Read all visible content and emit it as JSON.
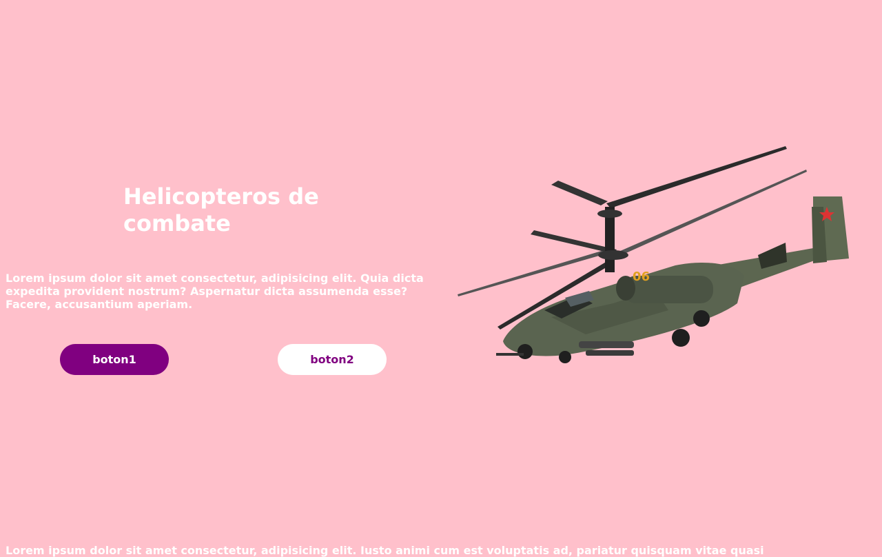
{
  "hero": {
    "title": "Helicopteros de combate",
    "description": "Lorem ipsum dolor sit amet consectetur, adipisicing elit. Quia dicta expedita provident nostrum? Aspernatur dicta assumenda esse? Facere, accusantium aperiam.",
    "button1_label": "boton1",
    "button2_label": "boton2",
    "image": {
      "icon": "attack-helicopter-image",
      "tail_number": "06"
    }
  },
  "footer": {
    "text": "Lorem ipsum dolor sit amet consectetur, adipisicing elit. Iusto animi cum est voluptatis ad, pariatur quisquam vitae quasi"
  },
  "colors": {
    "background": "#ffc0cb",
    "accent": "#800080",
    "text": "#ffffff"
  }
}
